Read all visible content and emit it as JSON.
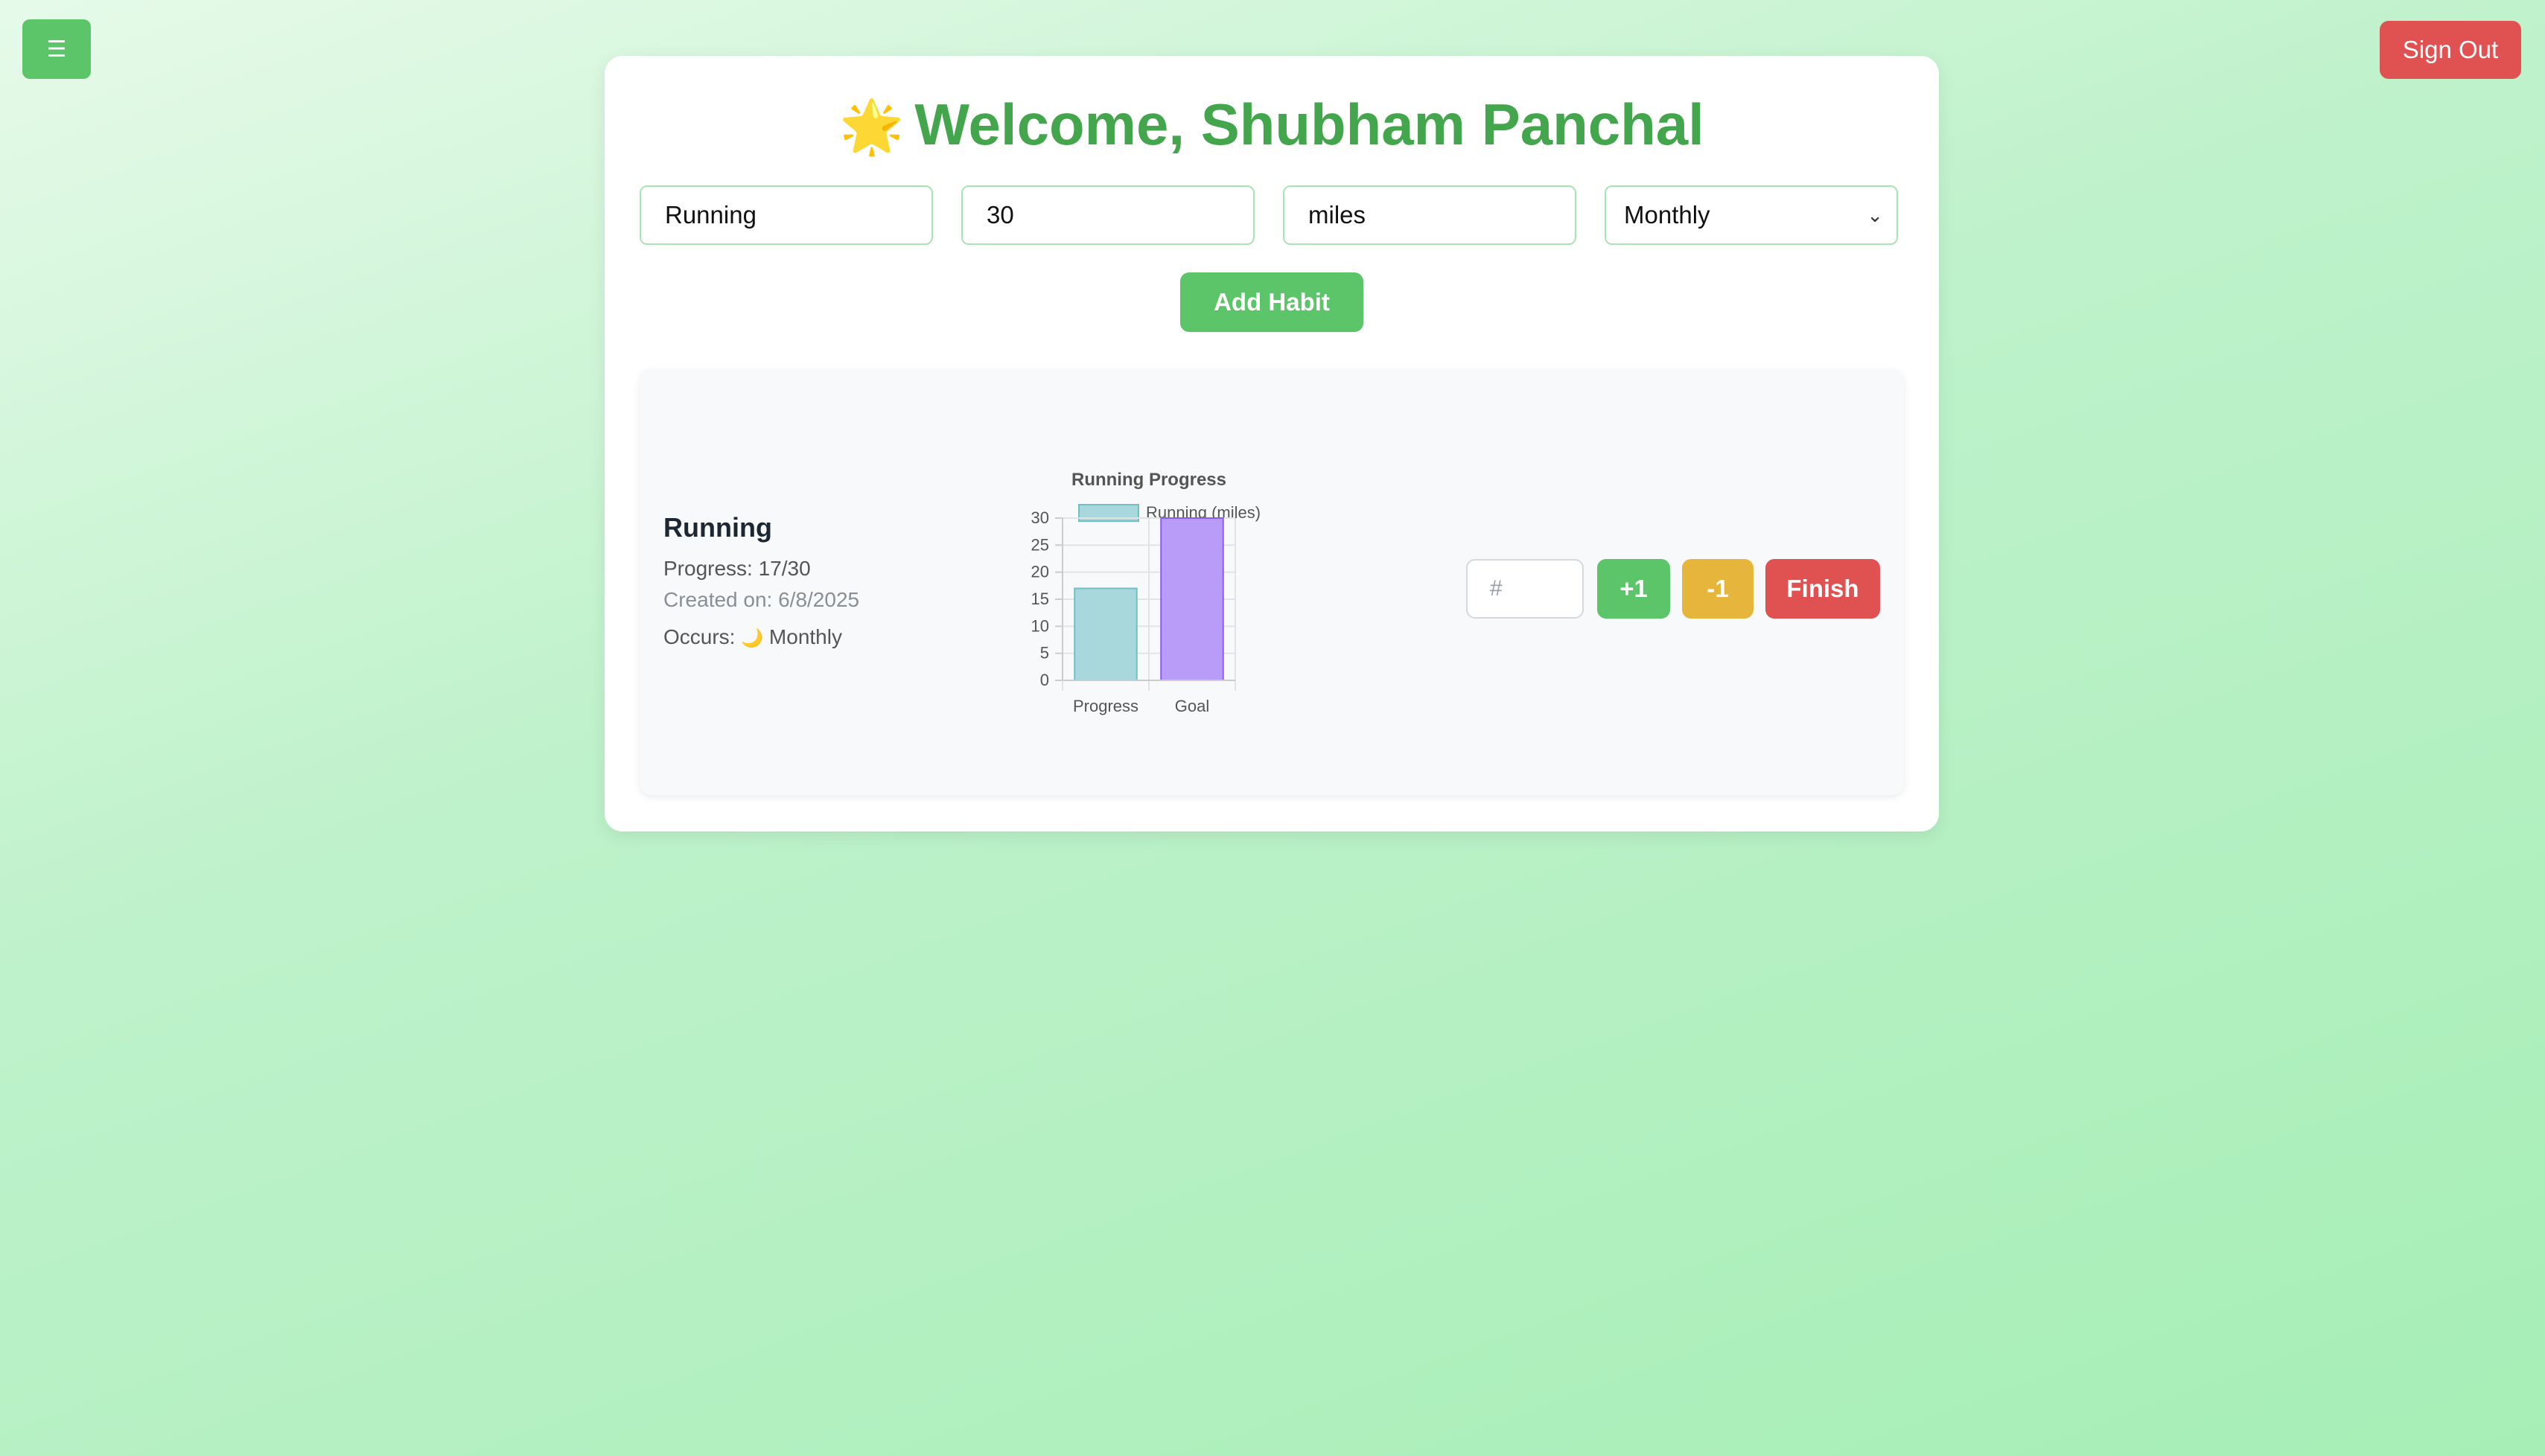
{
  "header": {
    "menu_icon": "☰",
    "signout_label": "Sign Out"
  },
  "main": {
    "title_icon": "🌟",
    "title": "Welcome, Shubham Panchal"
  },
  "form": {
    "habit_value": "Running",
    "goal_value": "30",
    "unit_value": "miles",
    "frequency_value": "Monthly",
    "add_label": "Add Habit"
  },
  "habit": {
    "name": "Running",
    "progress_text": "Progress: 17/30",
    "created_text": "Created on: 6/8/2025",
    "occurs_label": "Occurs:",
    "occurs_icon": "🌙",
    "occurs_value": "Monthly"
  },
  "controls": {
    "input_placeholder": "#",
    "plus_label": "+1",
    "minus_label": "-1",
    "finish_label": "Finish"
  },
  "colors": {
    "accent_green": "#5cc469",
    "title_green": "#43a54c",
    "danger_red": "#e05252",
    "warning_yellow": "#e6b53c"
  },
  "chart_data": {
    "type": "bar",
    "title": "Running Progress",
    "legend": [
      "Running (miles)"
    ],
    "legend_position": "top",
    "categories": [
      "Progress",
      "Goal"
    ],
    "values": [
      17,
      30
    ],
    "bar_colors": [
      "#a8d8dc",
      "#b89cf7"
    ],
    "bar_border_colors": [
      "#6fc0c6",
      "#8a5cf0"
    ],
    "ylim": [
      0,
      30
    ],
    "yticks": [
      0,
      5,
      10,
      15,
      20,
      25,
      30
    ],
    "grid": true
  }
}
